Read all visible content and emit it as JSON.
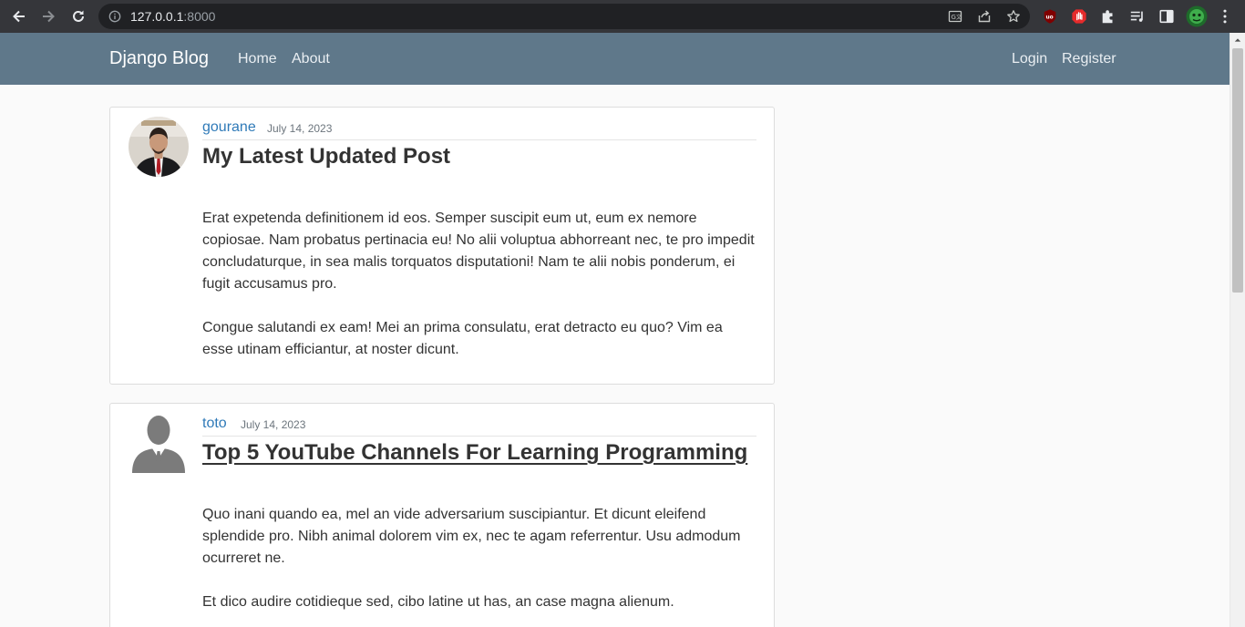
{
  "browser": {
    "url_host": "127.0.0.1",
    "url_port": ":8000"
  },
  "site": {
    "brand": "Django Blog",
    "nav_left": [
      "Home",
      "About"
    ],
    "nav_right": [
      "Login",
      "Register"
    ]
  },
  "posts": [
    {
      "author": "gourane",
      "date": "July 14, 2023",
      "title": "My Latest Updated Post",
      "paragraphs": [
        "Erat expetenda definitionem id eos. Semper suscipit eum ut, eum ex nemore copiosae. Nam probatus pertinacia eu! No alii voluptua abhorreant nec, te pro impedit concludaturque, in sea malis torquatos disputationi! Nam te alii nobis ponderum, ei fugit accusamus pro.",
        "Congue salutandi ex eam! Mei an prima consulatu, erat detracto eu quo? Vim ea esse utinam efficiantur, at noster dicunt."
      ]
    },
    {
      "author": "toto",
      "date": "July 14, 2023",
      "title": "Top 5 YouTube Channels For Learning Programming",
      "paragraphs": [
        "Quo inani quando ea, mel an vide adversarium suscipiantur. Et dicunt eleifend splendide pro. Nibh animal dolorem vim ex, nec te agam referrentur. Usu admodum ocurreret ne.",
        "Et dico audire cotidieque sed, cibo latine ut has, an case magna alienum."
      ]
    }
  ],
  "icons": {
    "back": "arrow-left-icon",
    "forward": "arrow-right-icon",
    "reload": "reload-icon",
    "info": "info-icon",
    "translate": "translate-icon",
    "share": "share-icon",
    "bookmark": "star-icon",
    "ublock": "ublock-icon",
    "adblock": "hand-stop-icon",
    "extensions": "puzzle-icon",
    "reading_list": "reading-list-icon",
    "side_panel": "side-panel-icon",
    "profile": "profile-avatar-icon",
    "menu": "kebab-menu-icon"
  },
  "colors": {
    "navbar": "#5f788a",
    "link": "#2f7ab8",
    "chrome": "#35363a"
  }
}
